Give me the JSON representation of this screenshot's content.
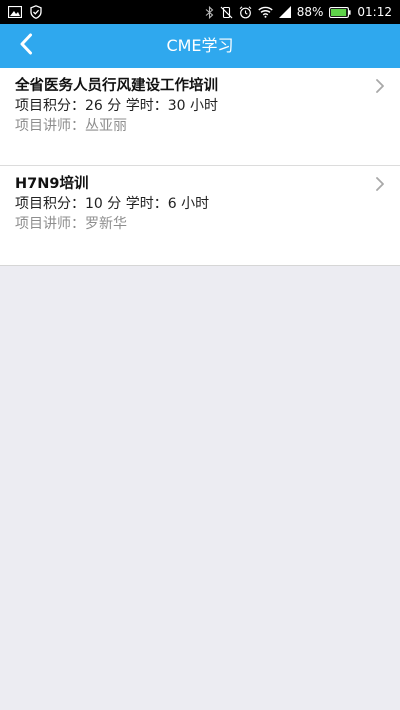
{
  "status_bar": {
    "battery_percent": "88%",
    "time": "01:12"
  },
  "app_bar": {
    "title": "CME学习"
  },
  "courses": [
    {
      "title": "全省医务人员行风建设工作培训",
      "meta": "项目积分：26 分 学时：30 小时",
      "teacher": "项目讲师：丛亚丽"
    },
    {
      "title": "H7N9培训",
      "meta": "项目积分：10 分 学时：6 小时",
      "teacher": "项目讲师：罗新华"
    }
  ],
  "colors": {
    "app_bar": "#2fa8ee",
    "status_bar": "#000000",
    "page_background": "#ececf2"
  }
}
